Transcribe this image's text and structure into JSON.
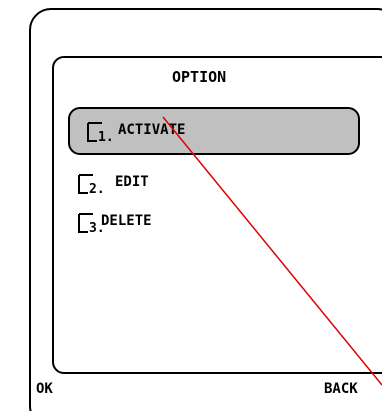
{
  "dialog": {
    "title": "OPTION"
  },
  "menu": {
    "items": [
      {
        "number": "1.",
        "label": "ACTIVATE",
        "selected": true,
        "icon": "document-icon"
      },
      {
        "number": "2.",
        "label": "EDIT",
        "selected": false,
        "icon": "document-icon"
      },
      {
        "number": "3.",
        "label": "DELETE",
        "selected": false,
        "icon": "document-icon"
      }
    ]
  },
  "softkeys": {
    "left": "OK",
    "right": "BACK"
  },
  "colors": {
    "selection": "#c0c0c0",
    "pointer_line": "#e00000",
    "outline": "#000000"
  }
}
